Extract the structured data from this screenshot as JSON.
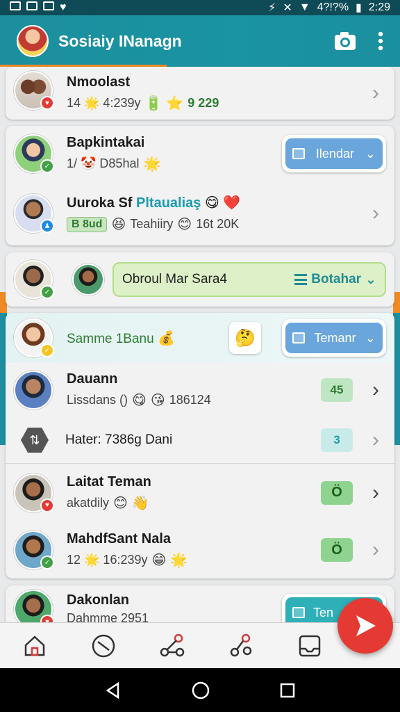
{
  "status_bar": {
    "battery": "4?!?%",
    "time": "2:29"
  },
  "header": {
    "title": "Sosiaiy INanagn"
  },
  "contacts_top": {
    "name": "Nmoolast",
    "sub": "14 🌟 4:239y",
    "tag": "9 229"
  },
  "group_two": {
    "row1": {
      "name": "Bapkintakai",
      "sub": "1/ 🤡 D85hal",
      "button": "Ilendar"
    },
    "row2": {
      "name": "Uuroka Sf",
      "name_highlight": "Pltaualiaş",
      "tag": "B 8ud",
      "sub": "Teahiiry",
      "count": "16t 20K"
    }
  },
  "search_row": {
    "field": "Obroul Mar Sara4",
    "select": "Botahar"
  },
  "group_four": {
    "row1": {
      "name": "Samme 1Banu",
      "button": "Temanr"
    },
    "row2": {
      "name": "Dauann",
      "sub": "Lissdans ()",
      "count": "186124",
      "chip": "45"
    },
    "row3": {
      "label": "Hater: 7386g Dani",
      "chip": "3"
    },
    "row4": {
      "name": "Laitat Teman",
      "sub": "akatdily",
      "chip": "Ö"
    },
    "row5": {
      "name": "MahdfSant Nala",
      "sub": "12 🌟 16:239y",
      "chip": "Ö"
    }
  },
  "bottom_partial": {
    "name": "Dakonlan",
    "sub": "Dahmme 2951",
    "button": "Ten"
  },
  "colors": {
    "teal": "#1a93a2",
    "orange": "#f08a24",
    "fab_red": "#e53a34",
    "button_blue": "#6aa6dc"
  },
  "icons": [
    "home-icon",
    "clock-icon",
    "share-icon",
    "network-icon",
    "inbox-icon",
    "send-icon"
  ]
}
